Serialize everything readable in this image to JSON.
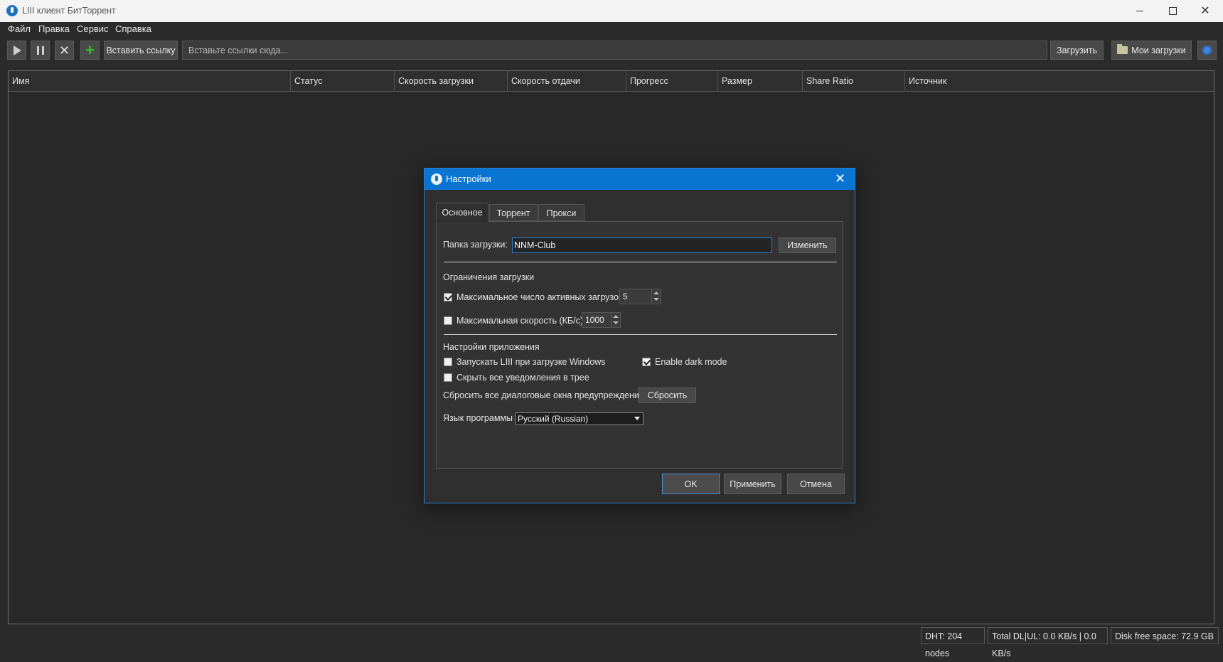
{
  "window": {
    "title": "LIII клиент БитТоррент"
  },
  "menu": {
    "file": "Файл",
    "edit": "Правка",
    "service": "Сервис",
    "help": "Справка"
  },
  "toolbar": {
    "paste_link": "Вставить ссылку",
    "url_placeholder": "Вставьте ссылки сюда...",
    "load": "Загрузить",
    "my_downloads": "Мои загрузки"
  },
  "table": {
    "columns": [
      "Имя",
      "Статус",
      "Скорость загрузки",
      "Скорость отдачи",
      "Прогресс",
      "Размер",
      "Share Ratio",
      "Источник"
    ]
  },
  "statusbar": {
    "dht": "DHT: 204 nodes",
    "total": "Total DL|UL: 0.0 KB/s | 0.0 KB/s",
    "disk": "Disk free space: 72.9 GB"
  },
  "dialog": {
    "title": "Настройки",
    "tabs": [
      "Основное",
      "Торрент",
      "Прокси"
    ],
    "folder_label": "Папка загрузки:",
    "folder_value": "NNM-Club",
    "change_button": "Изменить",
    "limits_header": "Ограничения загрузки",
    "max_active_label": "Максимальное число активных загрузок",
    "max_active_value": "5",
    "max_active_checked": true,
    "max_speed_label": "Максимальная скорость (КБ/с)",
    "max_speed_value": "1000",
    "max_speed_checked": false,
    "app_header": "Настройки приложения",
    "autostart_label": "Запускать LIII при загрузке Windows",
    "autostart_checked": false,
    "dark_mode_label": "Enable dark mode",
    "dark_mode_checked": true,
    "hide_notif_label": "Скрыть все уведомления в трее",
    "hide_notif_checked": false,
    "reset_label": "Сбросить все диалоговые окна предупреждений",
    "reset_button": "Сбросить",
    "language_label": "Язык программы",
    "language_value": "Русский (Russian)",
    "ok": "OK",
    "apply": "Применить",
    "cancel": "Отмена"
  }
}
